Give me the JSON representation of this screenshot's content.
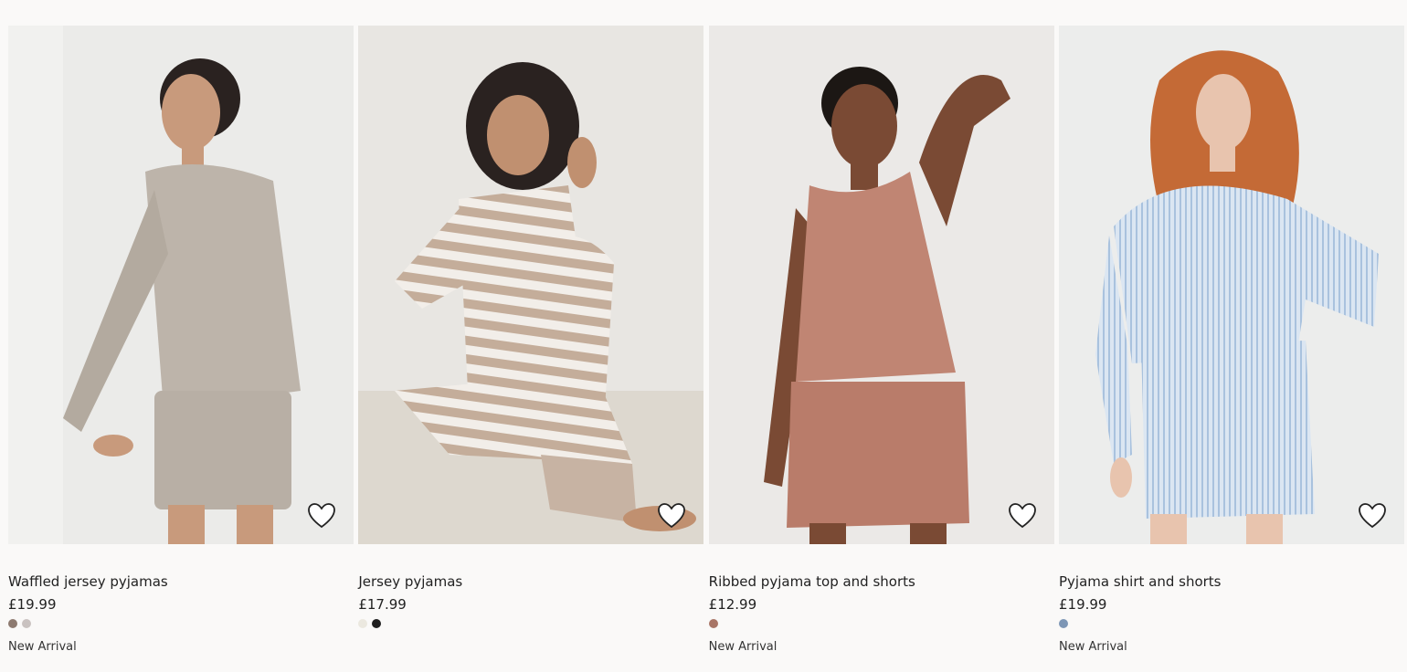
{
  "products": [
    {
      "title": "Waffled jersey pyjamas",
      "price": "£19.99",
      "badge": "New Arrival",
      "swatches": [
        "#8d7a70",
        "#c9c2c0"
      ],
      "image": {
        "bg": "#ebebe9",
        "garment": "#bdb4aa",
        "skin": "#c89a7c",
        "hair": "#2a2220"
      }
    },
    {
      "title": "Jersey pyjamas",
      "price": "£17.99",
      "badge": "",
      "swatches": [
        "#ebe8df",
        "#1f1f1f"
      ],
      "image": {
        "bg": "#e8e6e2",
        "garment": "#c7b3a3",
        "skin": "#c09070",
        "hair": "#2a2220"
      }
    },
    {
      "title": "Ribbed pyjama top and shorts",
      "price": "£12.99",
      "badge": "New Arrival",
      "swatches": [
        "#a87566"
      ],
      "image": {
        "bg": "#ebe9e7",
        "garment": "#c08573",
        "skin": "#7a4a34",
        "hair": "#1c1714"
      }
    },
    {
      "title": "Pyjama shirt and shorts",
      "price": "£19.99",
      "badge": "New Arrival",
      "swatches": [
        "#7d96b5"
      ],
      "image": {
        "bg": "#ecedec",
        "garment": "#c8d8ea",
        "skin": "#e8c4ae",
        "hair": "#c46a36"
      }
    }
  ]
}
